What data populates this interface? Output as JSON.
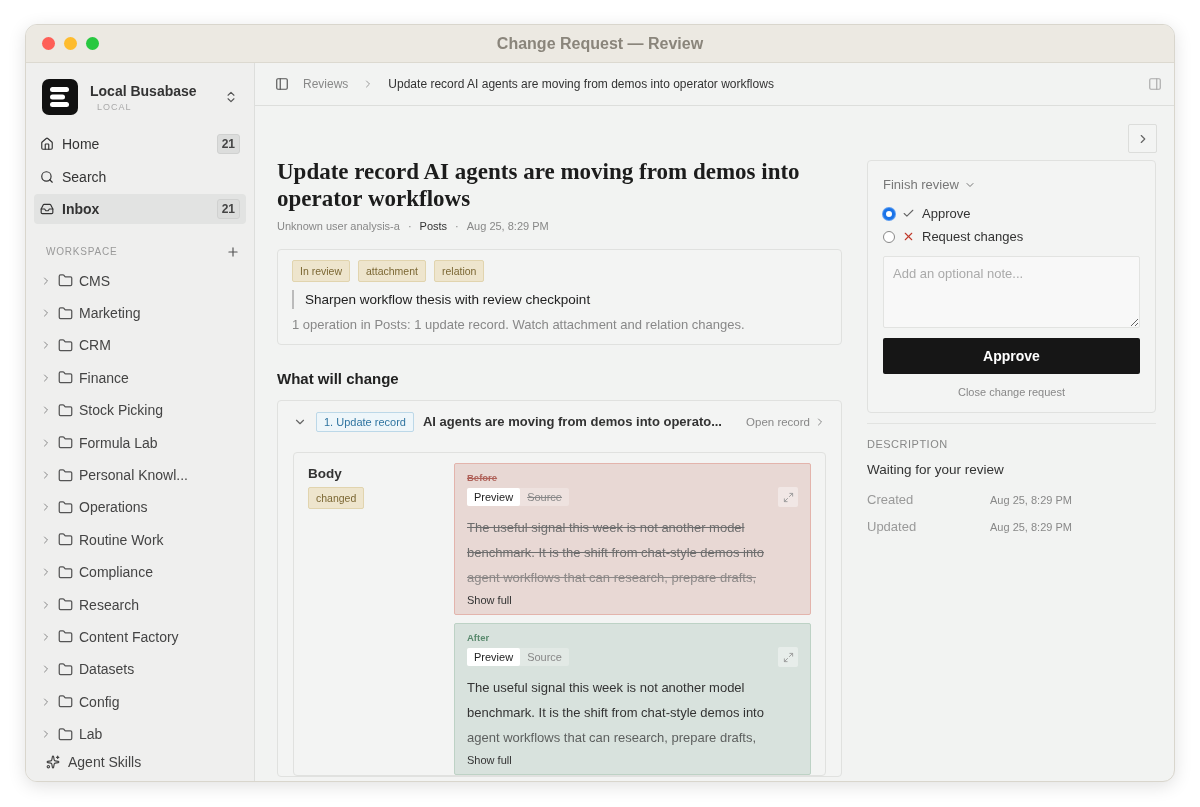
{
  "window": {
    "title": "Change Request — Review"
  },
  "workspace": {
    "name": "Local Busabase",
    "subtitle": "LOCAL"
  },
  "nav": [
    {
      "label": "Home",
      "kind": "home",
      "badge": "21",
      "selected": false
    },
    {
      "label": "Search",
      "kind": "search",
      "selected": false
    },
    {
      "label": "Inbox",
      "kind": "inbox",
      "badge": "21",
      "selected": true
    }
  ],
  "section_label": "WORKSPACE",
  "folders": [
    {
      "label": "CMS"
    },
    {
      "label": "Marketing"
    },
    {
      "label": "CRM"
    },
    {
      "label": "Finance"
    },
    {
      "label": "Stock Picking"
    },
    {
      "label": "Formula Lab"
    },
    {
      "label": "Personal Knowl..."
    },
    {
      "label": "Operations"
    },
    {
      "label": "Routine Work"
    },
    {
      "label": "Compliance"
    },
    {
      "label": "Research"
    },
    {
      "label": "Content Factory"
    },
    {
      "label": "Datasets"
    },
    {
      "label": "Config"
    },
    {
      "label": "Lab"
    }
  ],
  "footer_link": "Agent Skills",
  "breadcrumb": [
    "Reviews",
    "Update record AI agents are moving from demos into operator workflows"
  ],
  "request": {
    "title": "Update record AI agents are moving from demos into operator workflows",
    "author": "Unknown user analysis-a",
    "collection": "Posts",
    "time": "Aug 25, 8:29 PM",
    "separators": [
      "·",
      "·"
    ],
    "tags": [
      {
        "label": "In review"
      },
      {
        "label": "attachment"
      },
      {
        "label": "relation"
      }
    ],
    "quote": "Sharpen workflow thesis with review checkpoint",
    "summary": "1 operation in Posts: 1 update record. Watch attachment and relation changes."
  },
  "changes": {
    "heading": "What will change",
    "items": [
      {
        "number_label": "1. Update record",
        "title": "AI agents are moving from demos into operato...",
        "open_label": "Open record",
        "expanded": true,
        "fields": [
          {
            "name": "Body",
            "badge": "changed",
            "versions": [
              {
                "kind": "before",
                "label": "Before",
                "tabs": [
                  {
                    "label": "Preview",
                    "selected": true
                  },
                  {
                    "label": "Source",
                    "selected": false
                  }
                ],
                "text": "The useful signal this week is not another model benchmark. It is the shift from chat-style demos into agent workflows that can research, prepare drafts,",
                "more": "Show full"
              },
              {
                "kind": "after",
                "label": "After",
                "tabs": [
                  {
                    "label": "Preview",
                    "selected": true
                  },
                  {
                    "label": "Source",
                    "selected": false
                  }
                ],
                "text": "The useful signal this week is not another model benchmark. It is the shift from chat-style demos into agent workflows that can research, prepare drafts,",
                "more": "Show full"
              }
            ]
          }
        ]
      }
    ]
  },
  "review": {
    "heading": "Finish review",
    "options": [
      {
        "label": "Approve",
        "kind": "approve",
        "selected": true
      },
      {
        "label": "Request changes",
        "kind": "reject",
        "selected": false
      }
    ],
    "note_placeholder": "Add an optional note...",
    "submit": "Approve",
    "close_label": "Close change request"
  },
  "description": {
    "heading": "DESCRIPTION",
    "text": "Waiting for your review",
    "meta": [
      {
        "label": "Created",
        "value": "Aug 25, 8:29 PM"
      },
      {
        "label": "Updated",
        "value": "Aug 25, 8:29 PM"
      }
    ]
  }
}
